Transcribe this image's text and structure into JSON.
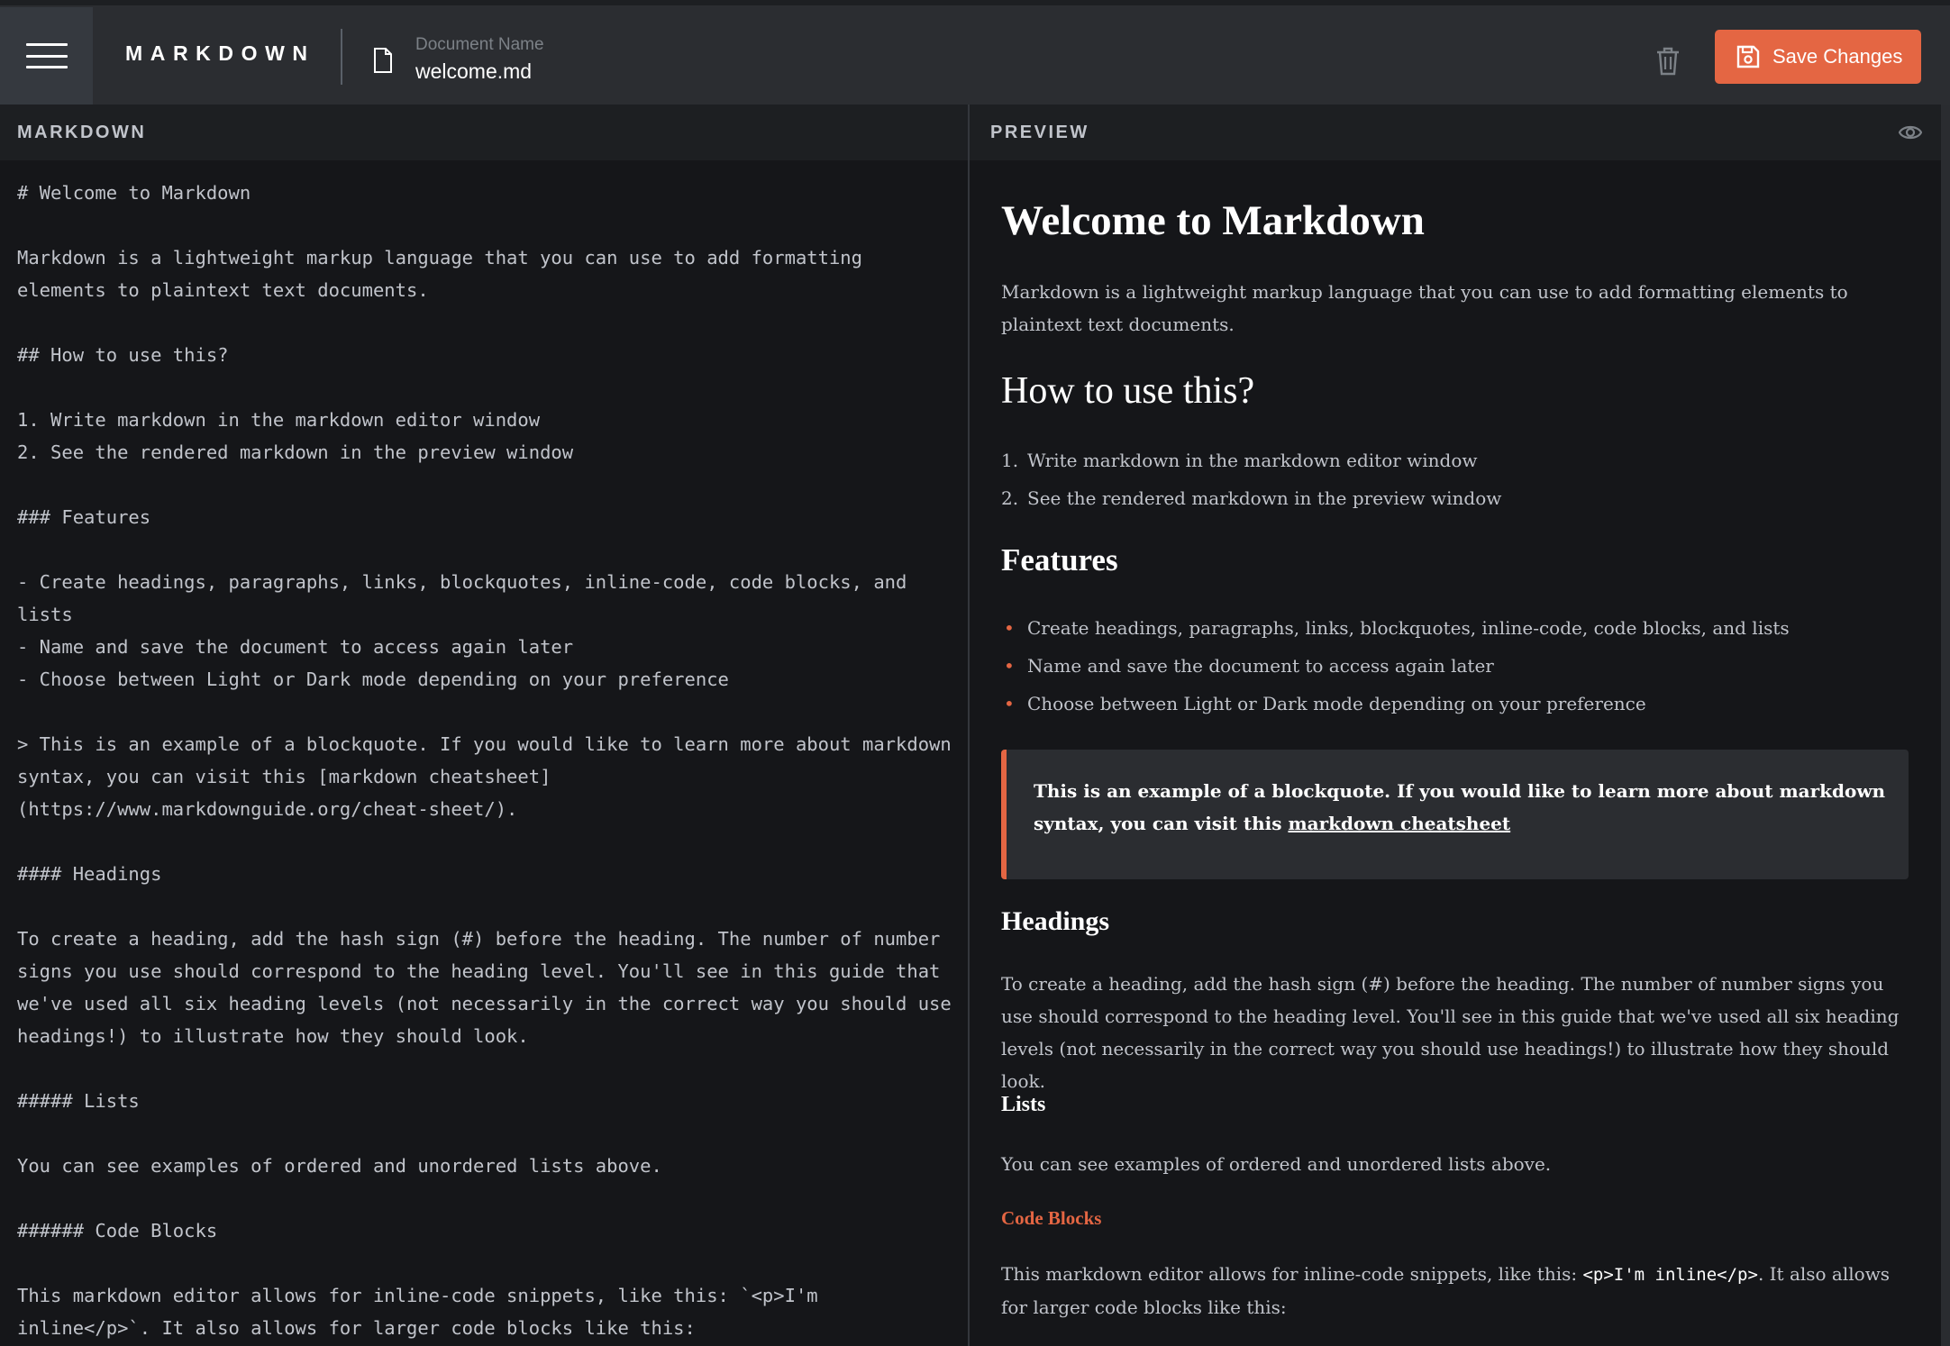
{
  "app": {
    "brand": "MARKDOWN"
  },
  "document": {
    "label": "Document Name",
    "name": "welcome.md"
  },
  "toolbar": {
    "save_label": "Save Changes"
  },
  "panes": {
    "markdown_title": "MARKDOWN",
    "preview_title": "PREVIEW"
  },
  "colors": {
    "accent": "#E46643",
    "topbar": "#2B2D31",
    "background": "#151619",
    "text": "#C1C4CB"
  },
  "icons": {
    "menu": "hamburger-icon",
    "document": "document-icon",
    "delete": "trash-icon",
    "save": "save-icon",
    "preview": "eye-icon"
  },
  "editor": {
    "content": "# Welcome to Markdown\n\nMarkdown is a lightweight markup language that you can use to add formatting elements to plaintext text documents.\n\n## How to use this?\n\n1. Write markdown in the markdown editor window\n2. See the rendered markdown in the preview window\n\n### Features\n\n- Create headings, paragraphs, links, blockquotes, inline-code, code blocks, and lists\n- Name and save the document to access again later\n- Choose between Light or Dark mode depending on your preference\n\n> This is an example of a blockquote. If you would like to learn more about markdown syntax, you can visit this [markdown cheatsheet](https://www.markdownguide.org/cheat-sheet/).\n\n#### Headings\n\nTo create a heading, add the hash sign (#) before the heading. The number of number signs you use should correspond to the heading level. You'll see in this guide that we've used all six heading levels (not necessarily in the correct way you should use headings!) to illustrate how they should look.\n\n##### Lists\n\nYou can see examples of ordered and unordered lists above.\n\n###### Code Blocks\n\nThis markdown editor allows for inline-code snippets, like this: `<p>I'm inline</p>`. It also allows for larger code blocks like this:"
  },
  "preview": {
    "h1": "Welcome to Markdown",
    "intro": "Markdown is a lightweight markup language that you can use to add formatting elements to plaintext text documents.",
    "h2": "How to use this?",
    "ordered": [
      "Write markdown in the markdown editor window",
      "See the rendered markdown in the preview window"
    ],
    "ordered_numbers": [
      "1.",
      "2."
    ],
    "h3": "Features",
    "unordered": [
      "Create headings, paragraphs, links, blockquotes, inline-code, code blocks, and lists",
      "Name and save the document to access again later",
      "Choose between Light or Dark mode depending on your preference"
    ],
    "bullet": "•",
    "blockquote_text": "This is an example of a blockquote. If you would like to learn more about markdown syntax, you can visit this ",
    "blockquote_link": "markdown cheatsheet",
    "h4": "Headings",
    "headings_text": "To create a heading, add the hash sign (#) before the heading. The number of number signs you use should correspond to the heading level. You'll see in this guide that we've used all six heading levels (not necessarily in the correct way you should use headings!) to illustrate how they should look.",
    "h5": "Lists",
    "lists_text": "You can see examples of ordered and unordered lists above.",
    "h6": "Code Blocks",
    "code_text_before": "This markdown editor allows for inline-code snippets, like this: ",
    "code_inline": "<p>I'm inline</p>",
    "code_text_after": ". It also allows for larger code blocks like this:"
  }
}
